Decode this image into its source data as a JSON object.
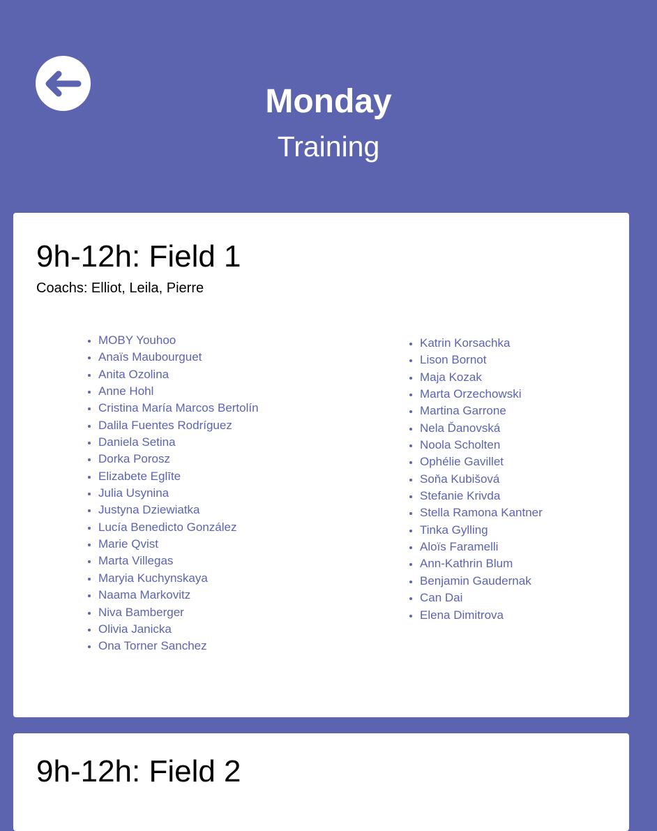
{
  "header": {
    "title": "Monday",
    "subtitle": "Training"
  },
  "icons": {
    "back": "arrow-left-icon"
  },
  "colors": {
    "background": "#5c64b0",
    "card": "#ffffff",
    "link": "#5c64b0",
    "text": "#000000"
  },
  "sessions": [
    {
      "title": "9h-12h: Field 1",
      "coaches": "Coachs: Elliot, Leila, Pierre",
      "players_left": [
        "MOBY Youhoo",
        "Anaïs Maubourguet",
        "Anita Ozolina",
        "Anne Hohl",
        "Cristina María Marcos Bertolín",
        "Dalila Fuentes Rodríguez",
        "Daniela Setina",
        "Dorka Porosz",
        "Elizabete Eglīte",
        "Julia Usynina",
        "Justyna Dziewiatka",
        "Lucía Benedicto González",
        "Marie Qvist",
        "Marta Villegas",
        "Maryia Kuchynskaya",
        "Naama Markovitz",
        "Niva Bamberger",
        "Olivia Janicka",
        "Ona Torner Sanchez"
      ],
      "players_right": [
        "Katrin Korsachka",
        "Lison Bornot",
        "Maja Kozak",
        "Marta Orzechowski",
        "Martina Garrone",
        "Nela Ďanovská",
        "Noola Scholten",
        "Ophélie Gavillet",
        "Soňa Kubišová",
        "Stefanie Krivda",
        "Stella Ramona Kantner",
        "Tinka Gylling",
        "Aloïs Faramelli",
        "Ann-Kathrin Blum",
        "Benjamin Gaudernak",
        "Can Dai",
        "Elena Dimitrova"
      ]
    },
    {
      "title": "9h-12h: Field 2"
    }
  ]
}
